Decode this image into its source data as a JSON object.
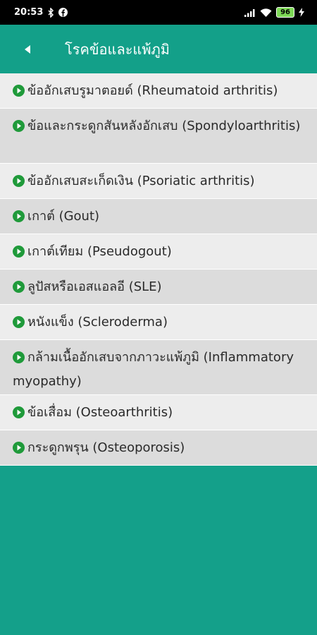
{
  "status": {
    "time": "20:53",
    "battery": "96"
  },
  "header": {
    "title": "โรคข้อและแพ้ภูมิ"
  },
  "items": [
    {
      "label": "ข้ออักเสบรูมาตอยด์ (Rheumatoid arthritis)"
    },
    {
      "label": "ข้อและกระดูกสันหลังอักเสบ (Spondyloarthritis)"
    },
    {
      "label": "ข้ออักเสบสะเก็ดเงิน (Psoriatic arthritis)"
    },
    {
      "label": "เกาต์ (Gout)"
    },
    {
      "label": "เกาต์เทียม (Pseudogout)"
    },
    {
      "label": "ลูปัสหรือเอสแอลอี (SLE)"
    },
    {
      "label": "หนังแข็ง (Scleroderma)"
    },
    {
      "label": "กล้ามเนื้ออักเสบจากภาวะแพ้ภูมิ (Inflammatory myopathy)"
    },
    {
      "label": "ข้อเสื่อม (Osteoarthritis)"
    },
    {
      "label": "กระดูกพรุน (Osteoporosis)"
    }
  ],
  "colors": {
    "accent": "#13a089",
    "bullet": "#1f9a3a"
  }
}
